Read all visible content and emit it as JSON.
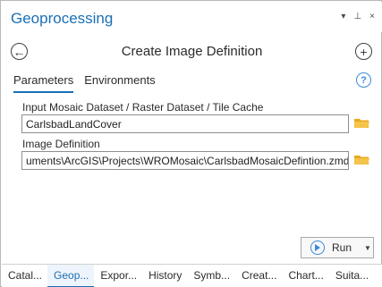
{
  "pane": {
    "title": "Geoprocessing",
    "controls": [
      "▾",
      "⊥",
      "×"
    ]
  },
  "tool": {
    "title": "Create Image Definition",
    "back_glyph": "←",
    "add_glyph": "+"
  },
  "tabs": [
    "Parameters",
    "Environments"
  ],
  "help_glyph": "?",
  "params": {
    "input_label": "Input Mosaic Dataset / Raster Dataset / Tile Cache",
    "input_value": "CarlsbadLandCover",
    "definition_label": "Image Definition",
    "definition_value": "C:\\Users\\Documents\\ArcGIS\\Projects\\WROMosaic\\CarlsbadMosaicDefintion.zmd",
    "definition_visible": "uments\\ArcGIS\\Projects\\WROMosaic\\CarlsbadMosaicDefintion.zmd"
  },
  "run": {
    "label": "Run"
  },
  "bottom_tabs": [
    "Catal...",
    "Geop...",
    "Expor...",
    "History",
    "Symb...",
    "Creat...",
    "Chart...",
    "Suita..."
  ],
  "colors": {
    "accent": "#1b6fb5",
    "folder": "#e8a820"
  }
}
